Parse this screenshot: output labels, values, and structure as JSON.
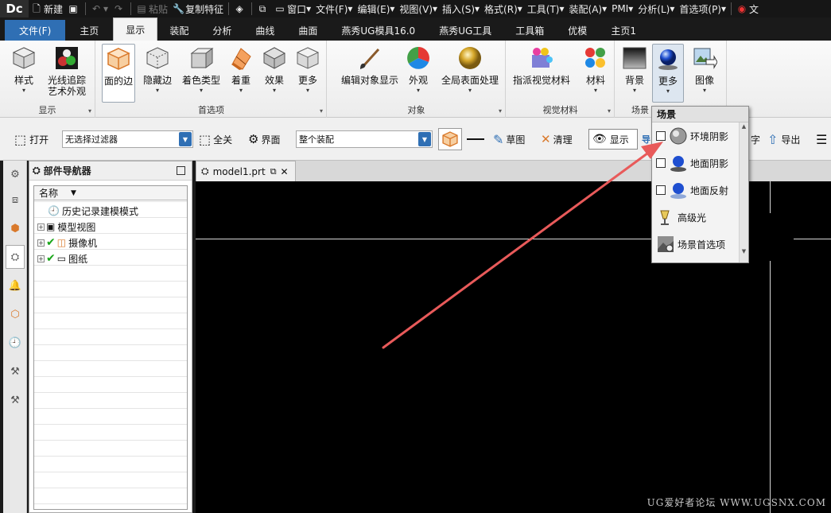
{
  "app": {
    "logo": "Dc"
  },
  "quickbar": {
    "new": "新建",
    "paste": "粘贴",
    "copy_feature": "复制特征",
    "menus": [
      "窗口",
      "文件(F)",
      "编辑(E)",
      "视图(V)",
      "插入(S)",
      "格式(R)",
      "工具(T)",
      "装配(A)",
      "PMI",
      "分析(L)",
      "首选项(P)"
    ],
    "cut_text": "文"
  },
  "tabs": [
    "文件(F)",
    "主页",
    "显示",
    "装配",
    "分析",
    "曲线",
    "曲面",
    "燕秀UG模具16.0",
    "燕秀UG工具",
    "工具箱",
    "优模",
    "主页1"
  ],
  "ribbon": {
    "groups": {
      "display": "显示",
      "preferences": "首选项",
      "object": "对象",
      "visual_material": "视觉材料",
      "scene": "场景"
    },
    "buttons": {
      "style": "样式",
      "raytrace_line1": "光线追踪",
      "raytrace_line2": "艺术外观",
      "face_edges": "面的边",
      "hidden_edges": "隐藏边",
      "shading_type": "着色类型",
      "shading": "着重",
      "effects": "效果",
      "more1": "更多",
      "edit_object_display": "编辑对象显示",
      "appearance": "外观",
      "global_surface": "全局表面处理",
      "assign_material": "指派视觉材料",
      "material": "材料",
      "background": "背景",
      "more2": "更多",
      "image": "图像"
    }
  },
  "toolbar": {
    "open": "打开",
    "filter_value": "无选择过滤器",
    "select_all": "全关",
    "interface": "界面",
    "assembly_value": "整个装配",
    "sketch": "草图",
    "clean": "清理",
    "display": "显示",
    "truncated_1": "导",
    "truncated_2": "字",
    "export": "导出"
  },
  "navigator": {
    "title": "部件导航器",
    "column_name": "名称",
    "nodes": [
      "历史记录建模模式",
      "模型视图",
      "摄像机",
      "图纸"
    ]
  },
  "document": {
    "tab": "model1.prt"
  },
  "scene_menu": {
    "title": "场景",
    "items": [
      "环境阴影",
      "地面阴影",
      "地面反射",
      "高级光",
      "场景首选项"
    ]
  },
  "watermark": "UG爱好者论坛 WWW.UGSNX.COM",
  "colors": {
    "accent": "#2f6fb4",
    "arrow": "#e85a5a",
    "check": "#18a518"
  }
}
